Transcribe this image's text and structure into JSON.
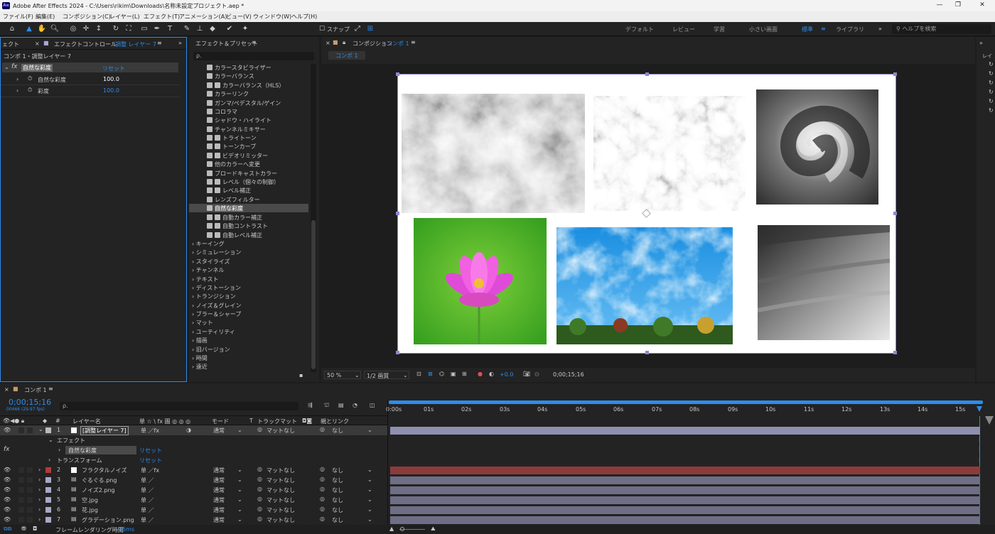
{
  "app": {
    "title": "Adobe After Effects 2024 - C:\\Users\\rikim\\Downloads\\名称未設定プロジェクト.aep *",
    "logo": "Ae",
    "window_controls": [
      "minimize-icon",
      "maximize-icon",
      "close-icon"
    ]
  },
  "menu": [
    "ファイル(F)",
    "編集(E)",
    "コンポジション(C)",
    "レイヤー(L)",
    "エフェクト(T)",
    "アニメーション(A)",
    "ビュー(V)",
    "ウィンドウ(W)",
    "ヘルプ(H)"
  ],
  "toolbar": {
    "snap_label": "スナップ",
    "workspaces": [
      "デフォルト",
      "レビュー",
      "学習",
      "小さい画面",
      "標準",
      "ライブラリ"
    ],
    "active_workspace": "標準",
    "help_search_placeholder": "ヘルプを検索",
    "more": "»"
  },
  "effect_controls": {
    "left_tab": "ェクト",
    "tab_label": "エフェクトコントロール",
    "tab_layer": "調整 レイヤー 7",
    "breadcrumb": "コンポ 1・調整レイヤー 7",
    "effect_name": "自然な彩度",
    "reset": "リセット",
    "props": [
      {
        "name": "自然な彩度",
        "value": "100.0"
      },
      {
        "name": "彩度",
        "value": "100.0"
      }
    ]
  },
  "effects_presets": {
    "tab_label": "エフェクト＆プリセット",
    "search_placeholder": "ρ.",
    "items": [
      "カラースタビライザー",
      "カラーバランス",
      "カラーバランス（HLS）",
      "カラーリンク",
      "ガンマ/ペデスタル/ゲイン",
      "コロラマ",
      "シャドウ・ハイライト",
      "チャンネルミキサー",
      "トライトーン",
      "トーンカーブ",
      "ビデオリミッター",
      "他のカラーへ変更",
      "ブロードキャストカラー",
      "レベル（個々の制御）",
      "レベル補正",
      "レンズフィルター",
      "自然な彩度",
      "自動カラー補正",
      "自動コントラスト",
      "自動レベル補正"
    ],
    "selected_item": "自然な彩度",
    "categories": [
      "キーイング",
      "シミュレーション",
      "スタイライズ",
      "チャンネル",
      "テキスト",
      "ディストーション",
      "トランジション",
      "ノイズ＆グレイン",
      "ブラー＆シャープ",
      "マット",
      "ユーティリティ",
      "描画",
      "旧バージョン",
      "時間",
      "遠近"
    ]
  },
  "composition": {
    "tab_prefix": "コンポジション",
    "tab_name": "コンポ 1",
    "sub_tab": "コンポ 1",
    "zoom": "50 %",
    "resolution": "1/2 画質",
    "exposure": "+0.0",
    "timecode": "0;00;15;16",
    "images": [
      "fractal-noise",
      "marble-noise",
      "spiral",
      "lotus-flower",
      "sky",
      "gradient"
    ]
  },
  "right_strip": {
    "label": "レイ"
  },
  "timeline": {
    "tab_label": "コンポ 1",
    "timecode": "0;00;15;16",
    "frames_fps": "00466 (29.97 fps)",
    "search_placeholder": "ρ.",
    "columns": {
      "num": "#",
      "name": "レイヤー名",
      "switches": "单 ☆ \\ fx 圖 ◎ ◎ ◎",
      "mode": "モード",
      "t": "T",
      "track_matte": "トラックマット",
      "parent": "親とリンク"
    },
    "ruler": [
      "0:00s",
      "01s",
      "02s",
      "03s",
      "04s",
      "05s",
      "06s",
      "07s",
      "08s",
      "09s",
      "10s",
      "11s",
      "12s",
      "13s",
      "14s",
      "15s"
    ],
    "layers": [
      {
        "num": "1",
        "name": "[調整レイヤー 7]",
        "color": "#bbbbbb",
        "mode": "通常",
        "matte": "マットなし",
        "parent": "なし",
        "bar": "#8f8fb0",
        "selected": true
      },
      {
        "num": "2",
        "name": "フラクタルノイズ",
        "color": "#b23a3a",
        "mode": "通常",
        "matte": "マットなし",
        "parent": "なし",
        "bar": "#8c3b3b"
      },
      {
        "num": "3",
        "name": "ぐるぐる.png",
        "color": "#a8a8c8",
        "mode": "通常",
        "matte": "マットなし",
        "parent": "なし",
        "bar": "#6e6e86"
      },
      {
        "num": "4",
        "name": "ノイズ2.png",
        "color": "#a8a8c8",
        "mode": "通常",
        "matte": "マットなし",
        "parent": "なし",
        "bar": "#6e6e86"
      },
      {
        "num": "5",
        "name": "空.jpg",
        "color": "#a8a8c8",
        "mode": "通常",
        "matte": "マットなし",
        "parent": "なし",
        "bar": "#6e6e86"
      },
      {
        "num": "6",
        "name": "花.jpg",
        "color": "#a8a8c8",
        "mode": "通常",
        "matte": "マットなし",
        "parent": "なし",
        "bar": "#6e6e86"
      },
      {
        "num": "7",
        "name": "グラデーション.png",
        "color": "#a8a8c8",
        "mode": "通常",
        "matte": "マットなし",
        "parent": "なし",
        "bar": "#6e6e86"
      }
    ],
    "effects_group": "エフェクト",
    "effect_item": "自然な彩度",
    "transform_group": "トランスフォーム",
    "reset": "リセット",
    "render_time_label": "フレームレンダリング時間",
    "render_time_value": "15ms"
  },
  "colors": {
    "accent": "#2d8ceb",
    "panel": "#232323",
    "bg": "#1d1d1d"
  }
}
